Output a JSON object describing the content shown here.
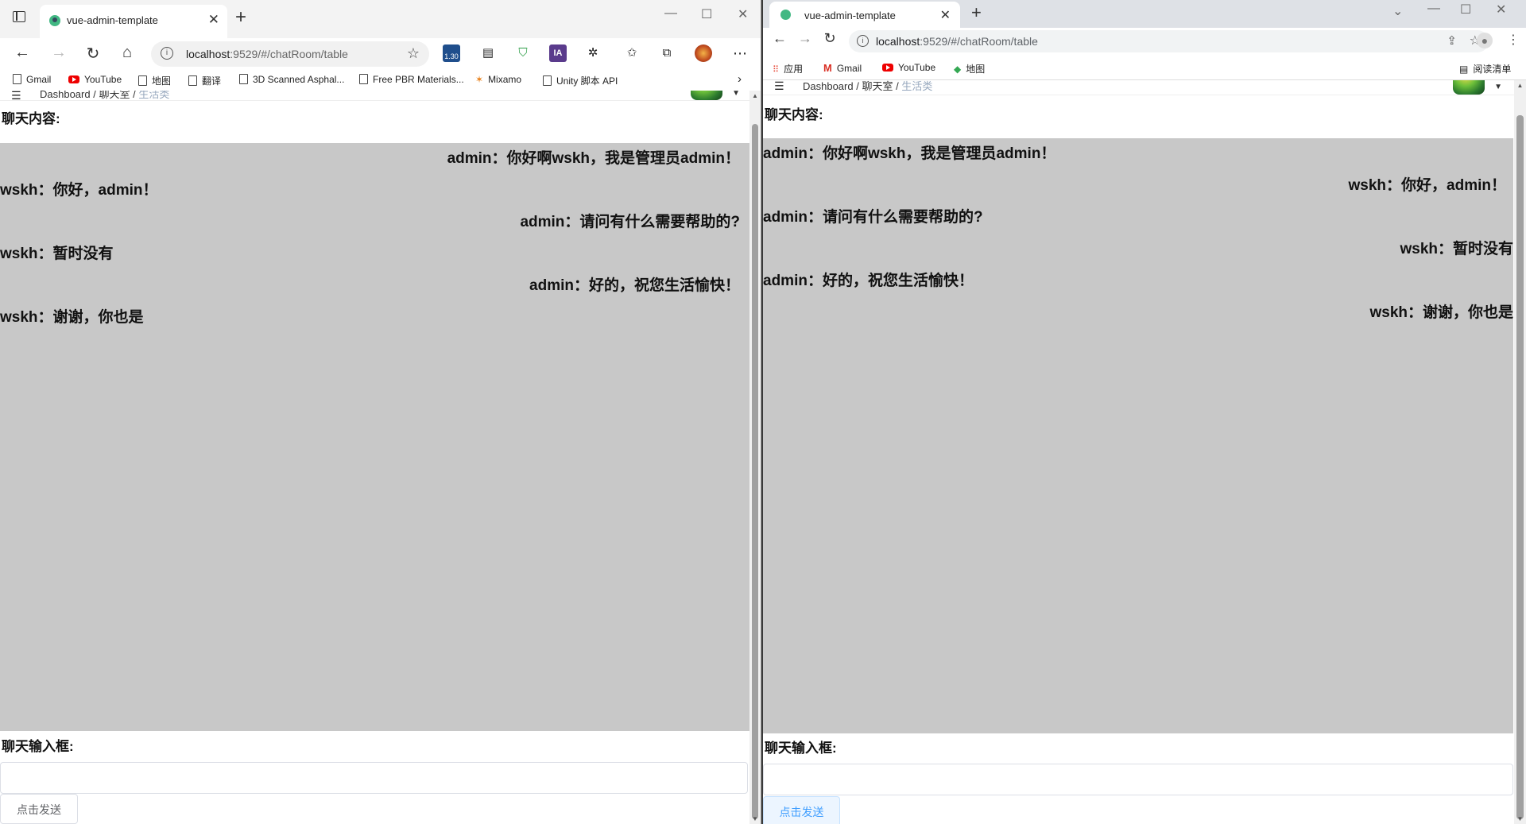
{
  "edge": {
    "tab_title": "vue-admin-template",
    "url_host": "localhost",
    "url_rest": ":9529/#/chatRoom/table",
    "ext_badge": "1.30",
    "bookmarks": [
      "Gmail",
      "YouTube",
      "地图",
      "翻译",
      "3D Scanned Asphal...",
      "Free PBR Materials...",
      "Mixamo",
      "Unity 脚本 API"
    ],
    "app": {
      "breadcrumb": [
        "Dashboard",
        "聊天室",
        "生活类"
      ],
      "chat_label": "聊天内容:",
      "input_label": "聊天输入框:",
      "send_label": "点击发送",
      "messages": [
        {
          "text": "admin：你好啊wskh，我是管理员admin！",
          "align": "right"
        },
        {
          "text": "wskh：你好，admin！",
          "align": "left"
        },
        {
          "text": "admin：请问有什么需要帮助的?",
          "align": "right"
        },
        {
          "text": "wskh：暂时没有",
          "align": "left"
        },
        {
          "text": "admin：好的，祝您生活愉快！",
          "align": "right"
        },
        {
          "text": "wskh：谢谢，你也是",
          "align": "left"
        }
      ]
    }
  },
  "chrome": {
    "tab_title": "vue-admin-template",
    "url_host": "localhost",
    "url_rest": ":9529/#/chatRoom/table",
    "bookmarks": [
      "应用",
      "Gmail",
      "YouTube",
      "地图"
    ],
    "reading_list": "阅读清单",
    "app": {
      "breadcrumb": [
        "Dashboard",
        "聊天室",
        "生活类"
      ],
      "chat_label": "聊天内容:",
      "input_label": "聊天输入框:",
      "send_label": "点击发送",
      "messages": [
        {
          "text": "admin：你好啊wskh，我是管理员admin！",
          "align": "left"
        },
        {
          "text": "wskh：你好，admin！",
          "align": "right"
        },
        {
          "text": "admin：请问有什么需要帮助的?",
          "align": "left"
        },
        {
          "text": "wskh：暂时没有",
          "align": "right"
        },
        {
          "text": "admin：好的，祝您生活愉快！",
          "align": "left"
        },
        {
          "text": "wskh：谢谢，你也是",
          "align": "right"
        }
      ]
    }
  },
  "colors": {
    "chat_bg": "#c8c8c8",
    "send_btn_chrome_bg": "#ecf5ff",
    "send_btn_chrome_fg": "#409eff",
    "breadcrumb_current": "#97a8be"
  }
}
